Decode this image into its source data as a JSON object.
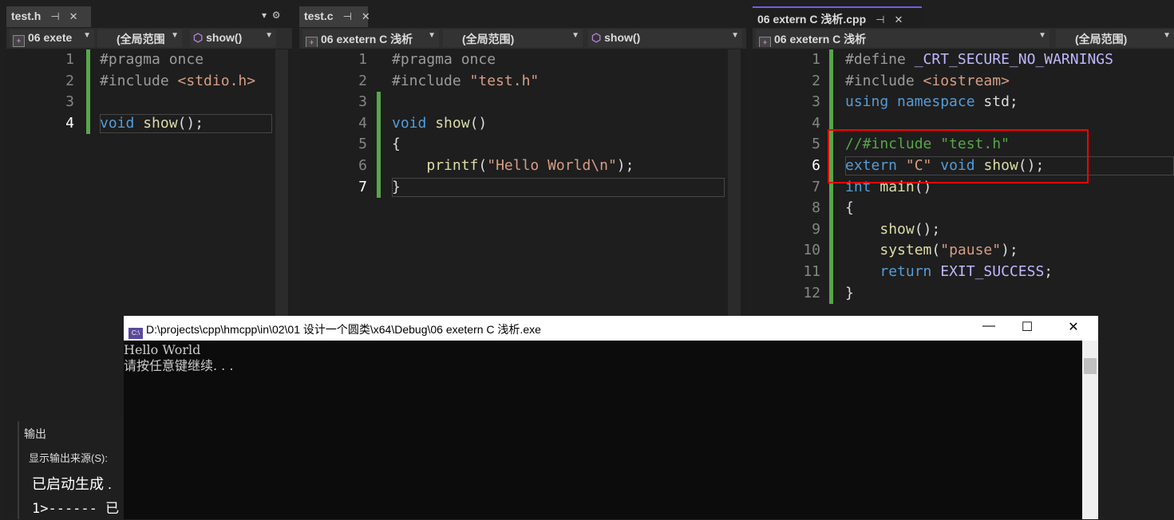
{
  "panes": [
    {
      "tab": "test.h",
      "nav": [
        "06 exete",
        "(全局范围",
        "show()"
      ],
      "current_line": 4,
      "lines": [
        [
          [
            "#pragma once",
            "pp"
          ]
        ],
        [
          [
            "#include ",
            "pp"
          ],
          [
            "<stdio.h>",
            "st"
          ]
        ],
        [],
        [
          [
            "void",
            "kw"
          ],
          [
            " ",
            "pl"
          ],
          [
            "show",
            "fn"
          ],
          [
            "();",
            "pl"
          ]
        ]
      ]
    },
    {
      "tab": "test.c",
      "nav": [
        "06 exetern C 浅析",
        "(全局范围)",
        "show()"
      ],
      "current_line": 7,
      "lines": [
        [
          [
            "#pragma once",
            "pp"
          ]
        ],
        [
          [
            "#include ",
            "pp"
          ],
          [
            "\"test.h\"",
            "st"
          ]
        ],
        [],
        [
          [
            "void",
            "kw"
          ],
          [
            " ",
            "pl"
          ],
          [
            "show",
            "fn"
          ],
          [
            "()",
            "pl"
          ]
        ],
        [
          [
            "{",
            "pl"
          ]
        ],
        [
          [
            "    ",
            "pl"
          ],
          [
            "printf",
            "fn"
          ],
          [
            "(",
            "pl"
          ],
          [
            "\"Hello World\\n\"",
            "st"
          ],
          [
            ");",
            "pl"
          ]
        ],
        [
          [
            "}",
            "pl"
          ]
        ]
      ]
    },
    {
      "tab": "06 extern C 浅析.cpp",
      "nav": [
        "06 exetern C 浅析",
        "(全局范围)"
      ],
      "current_line": 6,
      "lines": [
        [
          [
            "#define ",
            "pp"
          ],
          [
            "_CRT_SECURE_NO_WARNINGS",
            "mc"
          ]
        ],
        [
          [
            "#include ",
            "pp"
          ],
          [
            "<iostream>",
            "st"
          ]
        ],
        [
          [
            "using",
            "kw"
          ],
          [
            " ",
            "pl"
          ],
          [
            "namespace",
            "kw"
          ],
          [
            " std;",
            "pl"
          ]
        ],
        [],
        [
          [
            "//#include \"test.h\"",
            "cm"
          ]
        ],
        [
          [
            "extern",
            "kw"
          ],
          [
            " ",
            "pl"
          ],
          [
            "\"C\"",
            "st"
          ],
          [
            " ",
            "pl"
          ],
          [
            "void",
            "kw"
          ],
          [
            " ",
            "pl"
          ],
          [
            "show",
            "fn"
          ],
          [
            "();",
            "pl"
          ]
        ],
        [
          [
            "int",
            "kw"
          ],
          [
            " ",
            "pl"
          ],
          [
            "main",
            "fn"
          ],
          [
            "()",
            "pl"
          ]
        ],
        [
          [
            "{",
            "pl"
          ]
        ],
        [
          [
            "    ",
            "pl"
          ],
          [
            "show",
            "fn"
          ],
          [
            "();",
            "pl"
          ]
        ],
        [
          [
            "    ",
            "pl"
          ],
          [
            "system",
            "fn"
          ],
          [
            "(",
            "pl"
          ],
          [
            "\"pause\"",
            "st"
          ],
          [
            ");",
            "pl"
          ]
        ],
        [
          [
            "    ",
            "pl"
          ],
          [
            "return",
            "kw"
          ],
          [
            " ",
            "pl"
          ],
          [
            "EXIT_SUCCESS",
            "mc"
          ],
          [
            ";",
            "pl"
          ]
        ],
        [
          [
            "}",
            "pl"
          ]
        ]
      ]
    }
  ],
  "console": {
    "title": "D:\\projects\\cpp\\hmcpp\\in\\02\\01 设计一个圆类\\x64\\Debug\\06 exetern C 浅析.exe",
    "icon": "C:\\",
    "lines": [
      "Hello World",
      "请按任意键继续. . ."
    ],
    "minimize": "—",
    "maximize": "☐",
    "close": "✕"
  },
  "output": {
    "title": "输出",
    "source_label": "显示输出来源(S):",
    "lines": [
      "已启动生成 .",
      "1>------ 已"
    ]
  },
  "colors": {
    "highlight": "#ff0000",
    "accent": "#7160e8"
  }
}
